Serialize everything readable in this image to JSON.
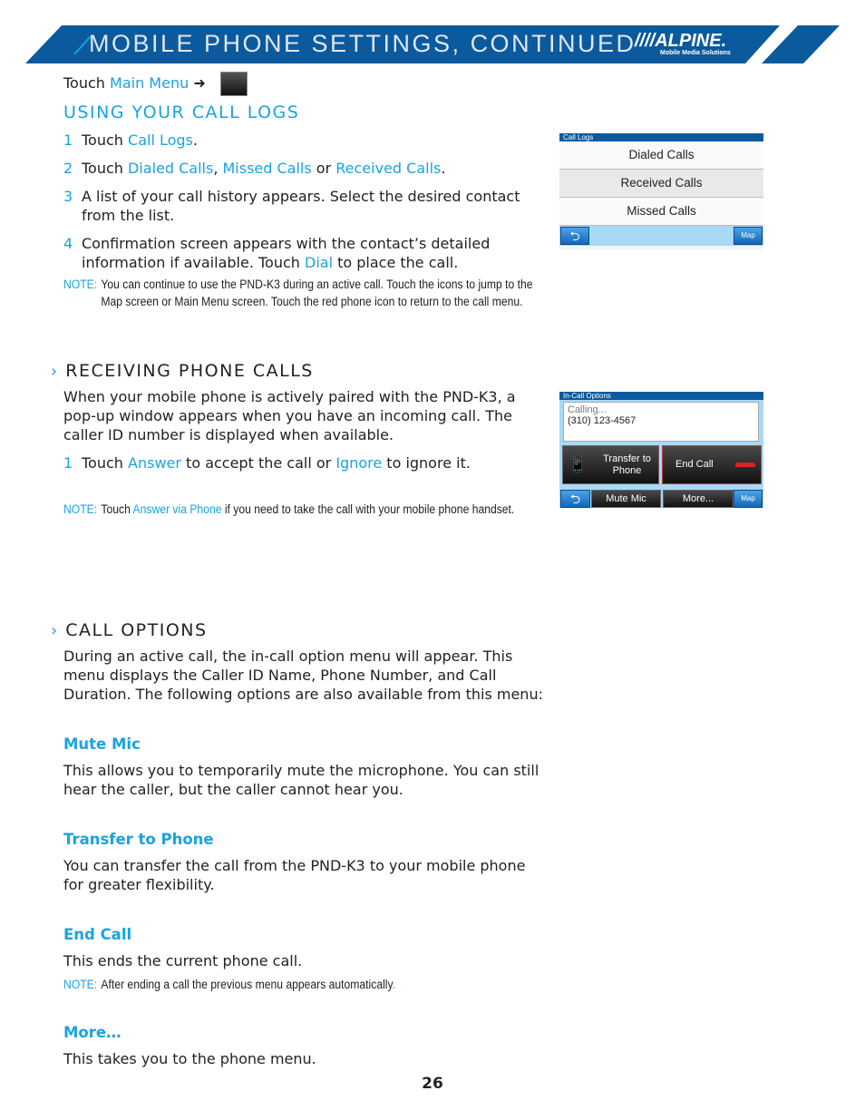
{
  "header": {
    "title": "MOBILE PHONE SETTINGS, CONTINUED",
    "logo": "////ALPINE.",
    "logo_sub": "Mobile Media Solutions",
    "brand_color": "#0b5a9e",
    "accent_color": "#1aa3e0"
  },
  "nav": {
    "touch": "Touch",
    "main_menu": "Main Menu",
    "arrow": "➜",
    "icon": "phone-menu-icon"
  },
  "call_logs": {
    "heading": "USING YOUR CALL LOGS",
    "steps": [
      {
        "n": "1",
        "parts": [
          "Touch ",
          "Call Logs",
          "."
        ]
      },
      {
        "n": "2",
        "parts": [
          "Touch ",
          "Dialed Calls",
          ", ",
          "Missed Calls",
          " or ",
          "Received Calls",
          "."
        ]
      },
      {
        "n": "3",
        "text": "A list of your call history appears. Select the desired contact from the list."
      },
      {
        "n": "4",
        "parts": [
          "Confirmation screen appears with the contact’s detailed information if available. Touch ",
          "Dial",
          " to place the call."
        ]
      }
    ],
    "note_label": "NOTE:",
    "note": "You can continue to use the PND-K3 during an active call. Touch the icons to jump to the Map screen or Main Menu screen. Touch the red phone icon to return to the call menu.",
    "screen": {
      "title": "Call Logs",
      "items": [
        "Dialed Calls",
        "Received Calls",
        "Missed Calls"
      ],
      "map": "Map"
    }
  },
  "receiving": {
    "heading": "RECEIVING PHONE CALLS",
    "body": "When your mobile phone is actively paired with the PND-K3, a pop-up window appears when you have an incoming call. The caller ID number is displayed when available.",
    "step": {
      "n": "1",
      "parts": [
        "Touch ",
        "Answer",
        " to accept the call or ",
        "Ignore",
        " to ignore it."
      ]
    },
    "note_label": "NOTE:",
    "note_parts": [
      "Touch ",
      "Answer via Phone",
      " if you need to take the call with your mobile phone handset."
    ],
    "screen": {
      "title": "In-Call Options",
      "status": "Calling...",
      "number": "(310) 123-4567",
      "transfer": "Transfer to Phone",
      "end": "End Call",
      "mute": "Mute Mic",
      "more": "More...",
      "map": "Map"
    }
  },
  "options": {
    "heading": "CALL OPTIONS",
    "body": "During an active call, the in-call option menu will appear. This menu displays the Caller ID Name, Phone Number, and Call Duration. The following options are also available from this menu:",
    "items": [
      {
        "title": "Mute Mic",
        "text": "This allows you to temporarily mute the microphone. You can still hear the caller, but the caller cannot hear you."
      },
      {
        "title": "Transfer to Phone",
        "text": "You can transfer the call from the PND-K3 to your mobile phone for greater flexibility."
      },
      {
        "title": "End Call",
        "text": "This ends the current phone call.",
        "note_label": "NOTE:",
        "note": "After ending a call the previous menu appears automatically",
        "note_end": "."
      },
      {
        "title": "More…",
        "text": "This takes you to the phone menu."
      }
    ]
  },
  "page_number": "26"
}
